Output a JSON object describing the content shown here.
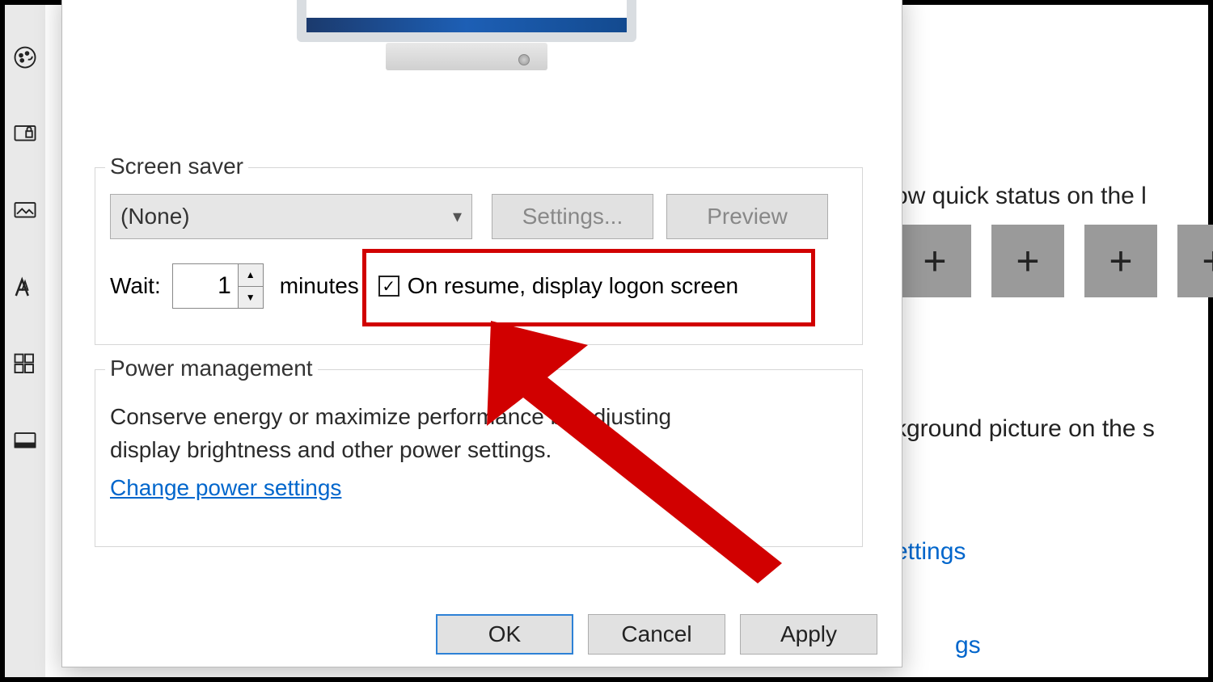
{
  "sidebar": {
    "icons": [
      "palette-icon",
      "lock-screen-icon",
      "themes-icon",
      "fonts-icon",
      "start-icon",
      "taskbar-icon"
    ]
  },
  "background": {
    "tip_status": "ow quick status on the l",
    "tip_background": "kground picture on the s",
    "link_settings_partial": "ettings",
    "link_gs_partial": "gs"
  },
  "screensaver": {
    "legend": "Screen saver",
    "selected": "(None)",
    "settings_btn": "Settings...",
    "preview_btn": "Preview",
    "wait_label": "Wait:",
    "wait_value": "1",
    "wait_unit": "minutes",
    "on_resume_label": "On resume, display logon screen",
    "on_resume_checked": true
  },
  "power": {
    "legend": "Power management",
    "description": "Conserve energy or maximize performance by adjusting display brightness and other power settings.",
    "link": "Change power settings"
  },
  "buttons": {
    "ok": "OK",
    "cancel": "Cancel",
    "apply": "Apply"
  }
}
